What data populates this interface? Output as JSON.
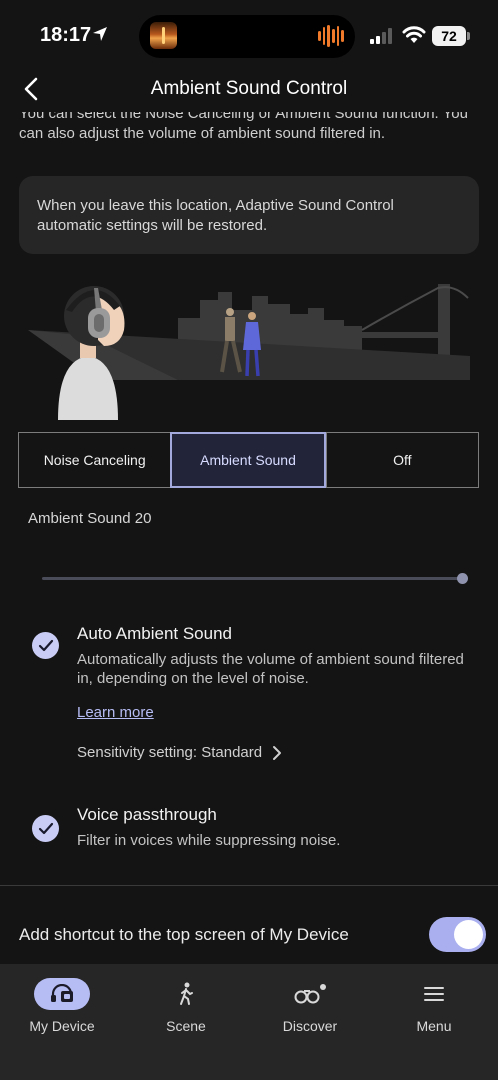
{
  "status_bar": {
    "time": "18:17",
    "battery": "72"
  },
  "header": {
    "title": "Ambient Sound Control"
  },
  "intro_text": "You can select the Noise Canceling or Ambient Sound function. You can also adjust the volume of ambient sound filtered in.",
  "notice_text": "When you leave this location, Adaptive Sound Control automatic settings will be restored.",
  "modes": {
    "items": [
      {
        "label": "Noise Canceling"
      },
      {
        "label": "Ambient Sound"
      },
      {
        "label": "Off"
      }
    ],
    "selected": "Ambient Sound"
  },
  "ambient_slider": {
    "label": "Ambient Sound 20",
    "level_fraction": 1.0
  },
  "auto_ambient": {
    "title": "Auto Ambient Sound",
    "description": "Automatically adjusts the volume of ambient sound filtered in, depending on the level of noise.",
    "learn_more": "Learn more",
    "sensitivity": "Sensitivity setting: Standard",
    "checked": true
  },
  "voice_passthrough": {
    "title": "Voice passthrough",
    "description": "Filter in voices while suppressing noise.",
    "checked": true
  },
  "shortcut": {
    "label": "Add shortcut to the top screen of My Device",
    "enabled": true
  },
  "tab_bar": {
    "items": [
      {
        "label": "My Device",
        "icon": "headphones-device-icon",
        "active": true
      },
      {
        "label": "Scene",
        "icon": "walking-person-icon"
      },
      {
        "label": "Discover",
        "icon": "binoculars-icon"
      },
      {
        "label": "Menu",
        "icon": "hamburger-menu-icon"
      }
    ]
  },
  "colors": {
    "accent": "#b6bcf4",
    "background": "#141414",
    "surface": "#262626",
    "selected_mode_bg": "#22243a"
  }
}
